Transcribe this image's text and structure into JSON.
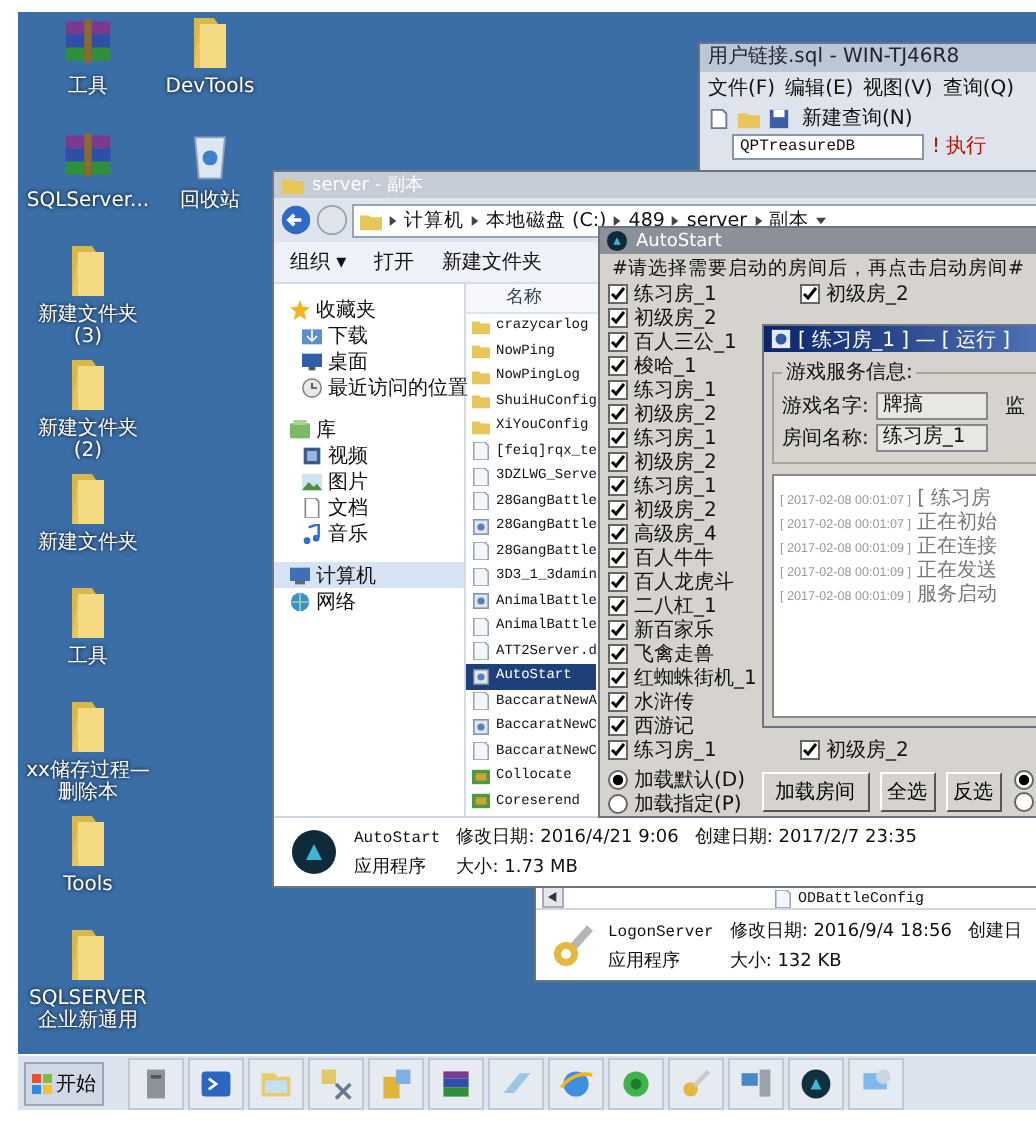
{
  "desktop_icons": [
    {
      "label": "工具",
      "kind": "archive"
    },
    {
      "label": "DevTools",
      "kind": "folder"
    },
    {
      "label": "SQLServer...",
      "kind": "archive"
    },
    {
      "label": "回收站",
      "kind": "recycle_bin"
    },
    {
      "label": "新建文件夹 (3)",
      "kind": "folder"
    },
    {
      "label": "新建文件夹 (2)",
      "kind": "folder"
    },
    {
      "label": "新建文件夹",
      "kind": "folder"
    },
    {
      "label": "工具",
      "kind": "folder"
    },
    {
      "label": "xx储存过程—删除本",
      "kind": "folder"
    },
    {
      "label": "Tools",
      "kind": "folder"
    },
    {
      "label": "SQLSERVER 企业新通用",
      "kind": "folder"
    }
  ],
  "query_window": {
    "title": "用户链接.sql - WIN-TJ46R8",
    "menu": [
      "文件(F)",
      "编辑(E)",
      "视图(V)",
      "查询(Q)"
    ],
    "new_query": "新建查询(N)",
    "database": "QPTreasureDB",
    "execute": "! 执行"
  },
  "explorer": {
    "title": "server - 副本",
    "path": [
      "计算机",
      "本地磁盘 (C:)",
      "489",
      "server",
      "副本"
    ],
    "toolbar": [
      "组织 ▾",
      "打开",
      "新建文件夹"
    ],
    "nav": [
      {
        "label": "收藏夹",
        "kind": "favorites",
        "selected": false,
        "children": [
          {
            "label": "下载",
            "kind": "download",
            "selected": false
          },
          {
            "label": "桌面",
            "kind": "desktop",
            "selected": false
          },
          {
            "label": "最近访问的位置",
            "kind": "recent",
            "selected": false
          }
        ]
      },
      {
        "label": "库",
        "kind": "library",
        "selected": false,
        "children": [
          {
            "label": "视频",
            "kind": "video",
            "selected": false
          },
          {
            "label": "图片",
            "kind": "picture",
            "selected": false
          },
          {
            "label": "文档",
            "kind": "document",
            "selected": false
          },
          {
            "label": "音乐",
            "kind": "music",
            "selected": false
          }
        ]
      },
      {
        "label": "计算机",
        "kind": "computer",
        "selected": true
      },
      {
        "label": "网络",
        "kind": "network",
        "selected": false
      }
    ],
    "column": "名称",
    "files": [
      {
        "name": "crazycarlog",
        "kind": "folder",
        "selected": false
      },
      {
        "name": "NowPing",
        "kind": "folder",
        "selected": false
      },
      {
        "name": "NowPingLog",
        "kind": "folder",
        "selected": false
      },
      {
        "name": "ShuiHuConfig",
        "kind": "folder",
        "selected": false
      },
      {
        "name": "XiYouConfig",
        "kind": "folder",
        "selected": false
      },
      {
        "name": "[feiq]rqx_te",
        "kind": "file",
        "selected": false
      },
      {
        "name": "3DZLWG_Serve",
        "kind": "file",
        "selected": false
      },
      {
        "name": "28GangBattle",
        "kind": "file",
        "selected": false
      },
      {
        "name": "28GangBattle",
        "kind": "app",
        "selected": false
      },
      {
        "name": "28GangBattle",
        "kind": "file",
        "selected": false
      },
      {
        "name": "3D3_1_3damin",
        "kind": "file",
        "selected": false
      },
      {
        "name": "AnimalBattle",
        "kind": "app",
        "selected": false
      },
      {
        "name": "AnimalBattle",
        "kind": "file",
        "selected": false
      },
      {
        "name": "ATT2Server.d",
        "kind": "file",
        "selected": false
      },
      {
        "name": "AutoStart",
        "kind": "app",
        "selected": true
      },
      {
        "name": "BaccaratNewA",
        "kind": "file",
        "selected": false
      },
      {
        "name": "BaccaratNewC",
        "kind": "app",
        "selected": false
      },
      {
        "name": "BaccaratNewC",
        "kind": "file",
        "selected": false
      },
      {
        "name": "Collocate",
        "kind": "tool",
        "selected": false
      },
      {
        "name": "Coreserend",
        "kind": "tool",
        "selected": false
      }
    ],
    "details": {
      "name": "AutoStart",
      "modified": "修改日期: 2016/4/21 9:06",
      "created": "创建日期: 2017/2/7 23:35",
      "type": "应用程序",
      "size": "大小: 1.73 MB"
    }
  },
  "explorer_behind": {
    "file": "ODBattleConfig",
    "details": {
      "name": "LogonServer",
      "modified": "修改日期: 2016/9/4 18:56",
      "created": "创建日",
      "type": "应用程序",
      "size": "大小: 132 KB"
    }
  },
  "autostart": {
    "title": "AutoStart",
    "instruction": "#请选择需要启动的房间后，再点击启动房间#",
    "rooms": [
      {
        "label": "练习房_1",
        "checked": true
      },
      {
        "label": "初级房_2",
        "checked": true
      },
      {
        "label": "百人三公_1",
        "checked": true
      },
      {
        "label": "梭哈_1",
        "checked": true
      },
      {
        "label": "练习房_1",
        "checked": true
      },
      {
        "label": "初级房_2",
        "checked": true
      },
      {
        "label": "练习房_1",
        "checked": true
      },
      {
        "label": "初级房_2",
        "checked": true
      },
      {
        "label": "练习房_1",
        "checked": true
      },
      {
        "label": "初级房_2",
        "checked": true
      },
      {
        "label": "高级房_4",
        "checked": true
      },
      {
        "label": "百人牛牛",
        "checked": true
      },
      {
        "label": "百人龙虎斗",
        "checked": true
      },
      {
        "label": "二八杠_1",
        "checked": true
      },
      {
        "label": "新百家乐",
        "checked": true
      },
      {
        "label": "飞禽走兽",
        "checked": true
      },
      {
        "label": "红蜘蛛街机_1",
        "checked": true
      },
      {
        "label": "水浒传",
        "checked": true
      },
      {
        "label": "西游记",
        "checked": true
      },
      {
        "label": "练习房_1",
        "checked": true
      }
    ],
    "rooms_right": [
      {
        "label": "初级房_2",
        "checked": true
      },
      {
        "label": "初级房_2",
        "checked": true
      }
    ],
    "load_options": [
      {
        "label": "加载默认(D)",
        "selected": true
      },
      {
        "label": "加载指定(P)",
        "selected": false
      }
    ],
    "buttons": [
      "加载房间",
      "全选",
      "反选"
    ],
    "side_options": [
      {
        "selected": true
      },
      {
        "selected": false
      }
    ]
  },
  "run_dialog": {
    "title": "[ 练习房_1 ] — [ 运行 ]",
    "group": "游戏服务信息:",
    "fields": [
      {
        "label": "游戏名字:",
        "value": "牌搞"
      },
      {
        "label": "房间名称:",
        "value": "练习房_1"
      }
    ],
    "side_label": "监",
    "log": [
      {
        "time": "[ 2017-02-08 00:01:07 ]",
        "message": "[ 练习房"
      },
      {
        "time": "[ 2017-02-08 00:01:07 ]",
        "message": "正在初始"
      },
      {
        "time": "[ 2017-02-08 00:01:09 ]",
        "message": "正在连接"
      },
      {
        "time": "[ 2017-02-08 00:01:09 ]",
        "message": "正在发送"
      },
      {
        "time": "[ 2017-02-08 00:01:09 ]",
        "message": "服务启动"
      }
    ]
  },
  "taskbar": {
    "start": "开始",
    "apps": [
      {
        "kind": "server"
      },
      {
        "kind": "terminal"
      },
      {
        "kind": "folder"
      },
      {
        "kind": "tools"
      },
      {
        "kind": "database"
      },
      {
        "kind": "archive"
      },
      {
        "kind": "notepad"
      },
      {
        "kind": "browser"
      },
      {
        "kind": "recycle"
      },
      {
        "kind": "key"
      },
      {
        "kind": "network"
      },
      {
        "kind": "orb"
      },
      {
        "kind": "computer"
      }
    ]
  }
}
